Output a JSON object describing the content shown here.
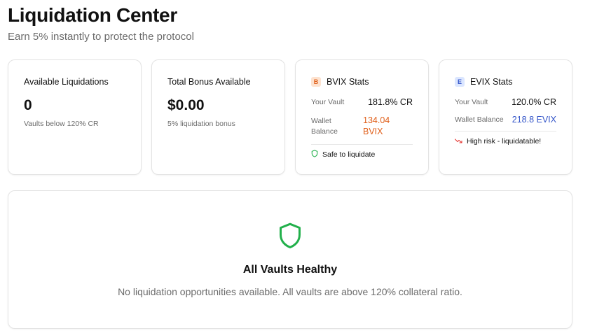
{
  "header": {
    "title": "Liquidation Center",
    "subtitle": "Earn 5% instantly to protect the protocol"
  },
  "cards": {
    "available": {
      "label": "Available Liquidations",
      "value": "0",
      "note": "Vaults below 120% CR"
    },
    "bonus": {
      "label": "Total Bonus Available",
      "value": "$0.00",
      "note": "5% liquidation bonus"
    }
  },
  "bvix": {
    "badge": "B",
    "title": "BVIX Stats",
    "vault_label": "Your Vault",
    "vault_value": "181.8% CR",
    "wallet_label_line1": "Wallet",
    "wallet_label_line2": "Balance",
    "wallet_value_line1": "134.04",
    "wallet_value_line2": "BVIX",
    "status": "Safe to liquidate",
    "status_icon": "shield-icon",
    "accent_color": "#e0601b"
  },
  "evix": {
    "badge": "E",
    "title": "EVIX Stats",
    "vault_label": "Your Vault",
    "vault_value": "120.0% CR",
    "wallet_label": "Wallet Balance",
    "wallet_value": "218.8 EVIX",
    "status": "High risk - liquidatable!",
    "status_icon": "trending-down-icon",
    "accent_color": "#3556c9"
  },
  "empty_state": {
    "icon": "shield-icon",
    "title": "All Vaults Healthy",
    "description": "No liquidation opportunities available. All vaults are above 120% collateral ratio.",
    "icon_color": "#22b04b"
  }
}
